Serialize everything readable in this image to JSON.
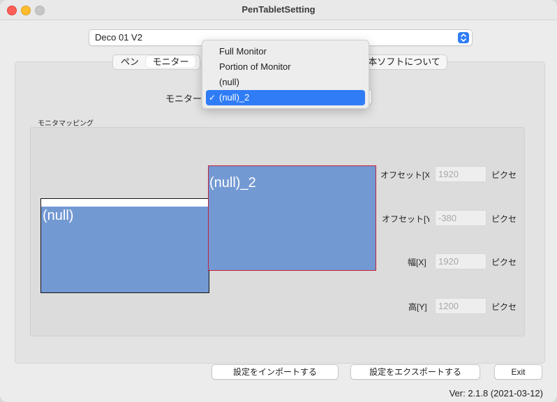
{
  "window": {
    "title": "PenTabletSetting"
  },
  "device": {
    "selected": "Deco 01 V2"
  },
  "tabs": [
    {
      "label": "ペン",
      "active": false
    },
    {
      "label": "モニター",
      "active": true
    },
    {
      "label": "本ソフトについて",
      "active": false
    }
  ],
  "monitor": {
    "label": "モニター"
  },
  "dropdown": {
    "items": [
      {
        "label": "Full Monitor",
        "selected": false
      },
      {
        "label": "Portion of Monitor",
        "selected": false
      },
      {
        "label": "(null)",
        "selected": false
      },
      {
        "label": "(null)_2",
        "selected": true
      }
    ],
    "check_mark": "✓"
  },
  "mapping": {
    "group_label": "モニタマッピング",
    "monitors": [
      {
        "label": "(null)"
      },
      {
        "label": "(null)_2",
        "highlighted": true
      }
    ],
    "fields": [
      {
        "label": "オフセット[X",
        "value": "1920",
        "unit": "ピクセ"
      },
      {
        "label": "オフセット[Y",
        "value": "-380",
        "unit": "ピクセ"
      },
      {
        "label": "幅[X]",
        "value": "1920",
        "unit": "ピクセ"
      },
      {
        "label": "高[Y]",
        "value": "1200",
        "unit": "ピクセ"
      }
    ]
  },
  "buttons": {
    "import": "設定をインポートする",
    "export": "設定をエクスポートする",
    "exit": "Exit"
  },
  "version": "Ver: 2.1.8 (2021-03-12)",
  "colors": {
    "accent": "#2f7cf6",
    "monitor_fill": "#7399d3",
    "highlight_border": "#c2203a"
  },
  "icons": [
    "close-icon",
    "minimize-icon",
    "zoom-icon",
    "updown-chevron-icon",
    "checkmark-icon"
  ]
}
